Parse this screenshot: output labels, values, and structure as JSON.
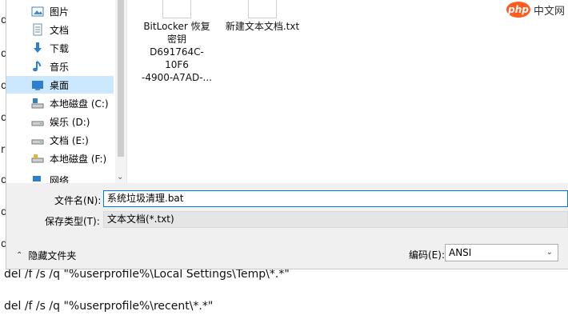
{
  "background_doc": {
    "lines": [
      "del /f /s /q \"%userprofile%\\Local Settings\\Temp\\*.*\"",
      "del /f /s /q \"%userprofile%\\recent\\*.*\""
    ],
    "margin_chars": [
      "d",
      "d",
      "d",
      "d",
      "r",
      "d",
      "d",
      "d"
    ]
  },
  "sidebar": {
    "items": [
      {
        "label": "图片",
        "icon": "pictures-icon"
      },
      {
        "label": "文档",
        "icon": "documents-icon"
      },
      {
        "label": "下载",
        "icon": "downloads-icon"
      },
      {
        "label": "音乐",
        "icon": "music-icon"
      },
      {
        "label": "桌面",
        "icon": "desktop-icon",
        "selected": true
      },
      {
        "label": "本地磁盘 (C:)",
        "icon": "system-drive-icon"
      },
      {
        "label": "娱乐 (D:)",
        "icon": "drive-icon"
      },
      {
        "label": "文档 (E:)",
        "icon": "drive-icon"
      },
      {
        "label": "本地磁盘 (F:)",
        "icon": "drive-icon"
      },
      {
        "label": "网络",
        "icon": "network-icon"
      }
    ]
  },
  "files": [
    {
      "name": "BitLocker 恢复\n密钥\nD691764C-10F6\n-4900-A7AD-..."
    },
    {
      "name": "新建文本文档.txt"
    }
  ],
  "form": {
    "filename_label": "文件名(N):",
    "filename_value": "系统垃圾清理.bat",
    "filetype_label": "保存类型(T):",
    "filetype_value": "文本文档(*.txt)",
    "encoding_label": "编码(E):",
    "encoding_value": "ANSI",
    "hide_folders_label": "隐藏文件夹"
  },
  "watermark": {
    "logo": "php",
    "text": "中文网"
  },
  "colors": {
    "selected": "#cce8ff",
    "accent": "#0078d7"
  }
}
